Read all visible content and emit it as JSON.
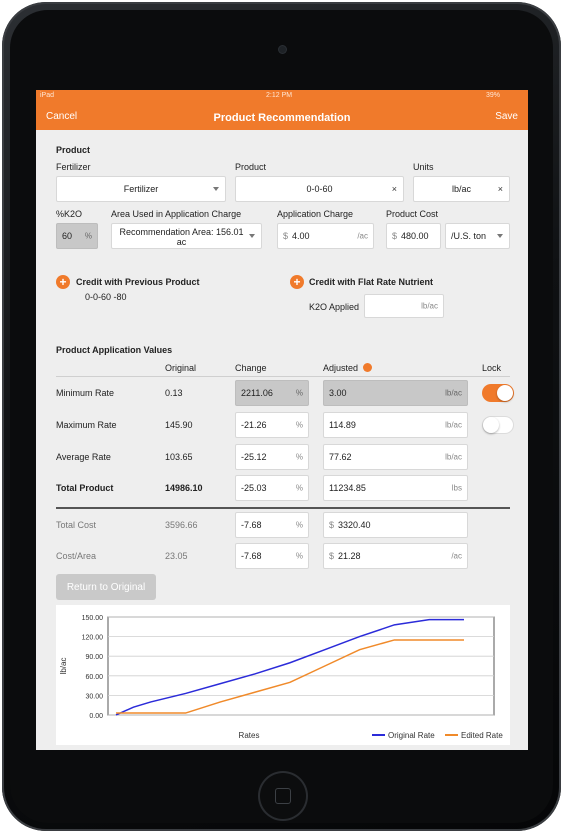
{
  "status": {
    "carrier": "iPad",
    "time": "2:12 PM",
    "battery": "39%"
  },
  "nav": {
    "cancel": "Cancel",
    "title": "Product Recommendation",
    "save": "Save"
  },
  "product": {
    "section_title": "Product",
    "fertilizer_label": "Fertilizer",
    "fertilizer_value": "Fertilizer",
    "product_label": "Product",
    "product_value": "0-0-60",
    "units_label": "Units",
    "units_value": "lb/ac",
    "clear_glyph": "×",
    "k2o_label": "%K2O",
    "k2o_value": "60",
    "k2o_unit": "%",
    "area_label": "Area Used in Application Charge",
    "area_value_line1": "Recommendation Area: 156.01",
    "area_value_line2": "ac",
    "charge_label": "Application Charge",
    "charge_currency": "$",
    "charge_value": "4.00",
    "charge_unit": "/ac",
    "cost_label": "Product Cost",
    "cost_currency": "$",
    "cost_value": "480.00",
    "cost_unit_value": "/U.S. ton"
  },
  "credits": {
    "plus_glyph": "+",
    "previous_label": "Credit with Previous Product",
    "previous_value": "0-0-60 -80",
    "flat_label": "Credit with Flat Rate Nutrient",
    "k2o_applied_label": "K2O Applied",
    "k2o_applied_unit": "lb/ac"
  },
  "application": {
    "section_title": "Product Application Values",
    "col_original": "Original",
    "col_change": "Change",
    "col_adjusted": "Adjusted",
    "col_lock": "Lock",
    "rows": [
      {
        "label": "Minimum Rate",
        "original": "0.13",
        "change": "2211.06",
        "change_unit": "%",
        "adjusted": "3.00",
        "adjusted_unit": "lb/ac"
      },
      {
        "label": "Maximum Rate",
        "original": "145.90",
        "change": "-21.26",
        "change_unit": "%",
        "adjusted": "114.89",
        "adjusted_unit": "lb/ac"
      },
      {
        "label": "Average Rate",
        "original": "103.65",
        "change": "-25.12",
        "change_unit": "%",
        "adjusted": "77.62",
        "adjusted_unit": "lb/ac"
      },
      {
        "label": "Total Product",
        "original": "14986.10",
        "change": "-25.03",
        "change_unit": "%",
        "adjusted": "11234.85",
        "adjusted_unit": "lbs"
      }
    ],
    "cost_rows": [
      {
        "label": "Total Cost",
        "original": "3596.66",
        "change": "-7.68",
        "change_unit": "%",
        "currency": "$",
        "adjusted": "3320.40",
        "adjusted_unit": ""
      },
      {
        "label": "Cost/Area",
        "original": "23.05",
        "change": "-7.68",
        "change_unit": "%",
        "currency": "$",
        "adjusted": "21.28",
        "adjusted_unit": "/ac"
      }
    ],
    "lock_minimum": true,
    "lock_maximum": false
  },
  "return_button": "Return to Original",
  "colors": {
    "accent": "#f07a2b",
    "original_series": "#2b2bd9",
    "edited_series": "#f08a2a"
  },
  "chart_data": {
    "type": "line",
    "xlabel": "Rates",
    "ylabel": "lb/ac",
    "ylim": [
      0,
      150
    ],
    "yticks": [
      "150.00",
      "120.00",
      "90.00",
      "60.00",
      "30.00",
      "0.00"
    ],
    "grid": true,
    "legend_position": "bottom-right",
    "x": [
      0,
      5,
      10,
      20,
      30,
      40,
      50,
      60,
      70,
      80,
      90,
      100
    ],
    "series": [
      {
        "name": "Original Rate",
        "values": [
          0.13,
          12,
          20,
          33,
          48,
          63,
          80,
          100,
          120,
          138,
          145.9,
          145.9
        ]
      },
      {
        "name": "Edited Rate",
        "values": [
          3,
          3,
          3,
          3,
          20,
          35,
          50,
          75,
          100,
          114.89,
          114.89,
          114.89
        ]
      }
    ]
  }
}
